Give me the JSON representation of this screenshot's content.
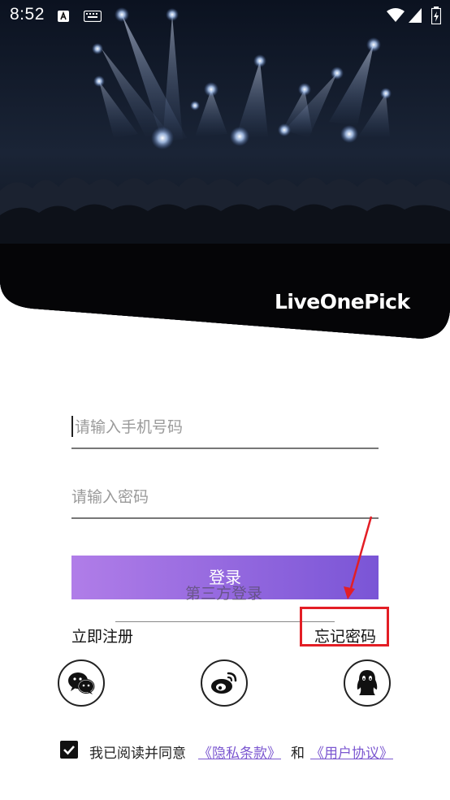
{
  "status_bar": {
    "time": "8:52"
  },
  "hero": {
    "brand": "LiveOnePick"
  },
  "login_form": {
    "phone_placeholder": "请输入手机号码",
    "password_placeholder": "请输入密码",
    "login_label": "登录"
  },
  "links": {
    "register": "立即注册",
    "forgot_password": "忘记密码"
  },
  "third_party": {
    "title": "第三方登录",
    "providers": [
      "wechat-icon",
      "weibo-icon",
      "qq-icon"
    ]
  },
  "agreement": {
    "checked": true,
    "prefix": "我已阅读并同意",
    "privacy": "《隐私条款》",
    "and": "和",
    "user_agreement": "《用户协议》"
  },
  "colors": {
    "accent_start": "#b07de8",
    "accent_end": "#7a55d6",
    "link": "#7b57d0",
    "annotation": "#e31e25"
  }
}
